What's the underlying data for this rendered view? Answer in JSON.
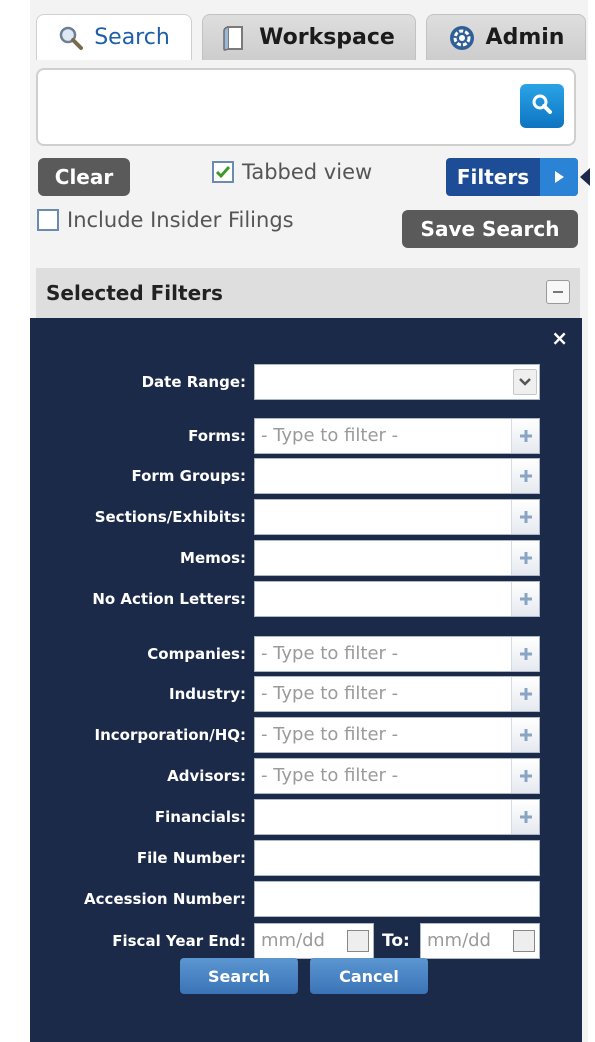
{
  "tabs": [
    {
      "label": "Search",
      "icon": "magnifier-icon",
      "active": true
    },
    {
      "label": "Workspace",
      "icon": "book-icon",
      "active": false
    },
    {
      "label": "Admin",
      "icon": "gear-icon",
      "active": false
    }
  ],
  "search": {
    "value": "",
    "placeholder": ""
  },
  "controls": {
    "clear_label": "Clear",
    "tabbed_view_label": "Tabbed view",
    "tabbed_view_checked": true,
    "filters_label": "Filters",
    "include_insider_label": "Include Insider Filings",
    "include_insider_checked": false,
    "save_search_label": "Save Search"
  },
  "selected_filters": {
    "title": "Selected Filters"
  },
  "filters_panel": {
    "close_label": "×",
    "date_range": {
      "label": "Date Range:",
      "value": ""
    },
    "forms": {
      "label": "Forms:",
      "placeholder": "- Type to filter -"
    },
    "form_groups": {
      "label": "Form Groups:",
      "placeholder": ""
    },
    "sections_exhibits": {
      "label": "Sections/Exhibits:",
      "placeholder": ""
    },
    "memos": {
      "label": "Memos:",
      "placeholder": ""
    },
    "no_action_letters": {
      "label": "No Action Letters:",
      "placeholder": ""
    },
    "companies": {
      "label": "Companies:",
      "placeholder": "- Type to filter -"
    },
    "industry": {
      "label": "Industry:",
      "placeholder": "- Type to filter -"
    },
    "incorporation_hq": {
      "label": "Incorporation/HQ:",
      "placeholder": "- Type to filter -"
    },
    "advisors": {
      "label": "Advisors:",
      "placeholder": "- Type to filter -"
    },
    "financials": {
      "label": "Financials:",
      "placeholder": ""
    },
    "file_number": {
      "label": "File Number:",
      "value": ""
    },
    "accession_number": {
      "label": "Accession Number:",
      "value": ""
    },
    "fiscal_year_end": {
      "label": "Fiscal Year End:",
      "from_placeholder": "mm/dd",
      "to_label": "To:",
      "to_placeholder": "mm/dd"
    },
    "search_label": "Search",
    "cancel_label": "Cancel"
  }
}
